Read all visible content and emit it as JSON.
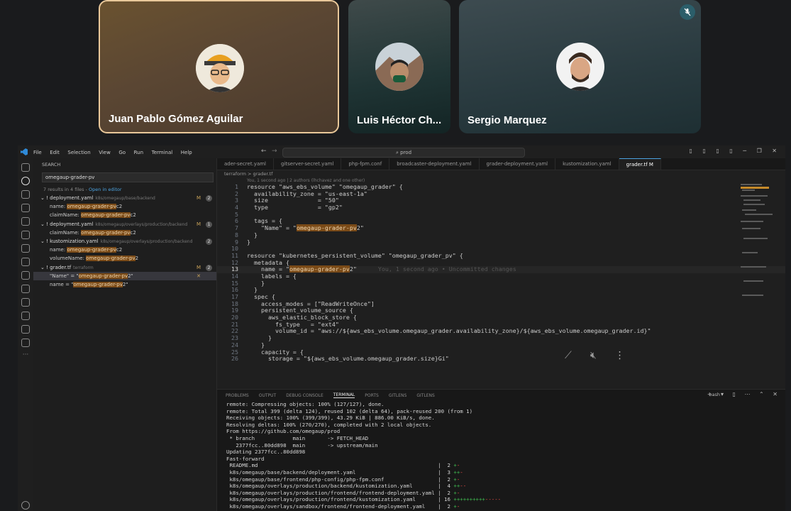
{
  "meeting": {
    "participants": [
      {
        "name": "Juan Pablo Gómez Aguilar",
        "active_speaker": true
      },
      {
        "name": "Luis Héctor Ch...",
        "active_speaker": false
      },
      {
        "name": "Sergio Marquez",
        "active_speaker": false,
        "muted": true
      }
    ]
  },
  "vscode": {
    "menu": [
      "File",
      "Edit",
      "Selection",
      "View",
      "Go",
      "Run",
      "Terminal",
      "Help"
    ],
    "command_center": "prod",
    "sidebar": {
      "title": "SEARCH",
      "query": "omegaup-grader-pv",
      "results_summary": "7 results in 4 files - ",
      "open_in_editor": "Open in editor",
      "files": [
        {
          "name": "deployment.yaml",
          "path": "k8s/omegaup/base/backend",
          "flag": "M",
          "count": "2",
          "matches": [
            [
              "name: ",
              "omegaup-grader-pv",
              "c2"
            ],
            [
              "claimName: ",
              "omegaup-grader-pv",
              "c2"
            ]
          ]
        },
        {
          "name": "deployment.yaml",
          "path": "k8s/omegaup/overlays/production/backend",
          "flag": "M",
          "count": "1",
          "matches": [
            [
              "claimName: ",
              "omegaup-grader-pv",
              "c2"
            ]
          ]
        },
        {
          "name": "kustomization.yaml",
          "path": "k8s/omegaup/overlays/production/backend",
          "flag": "",
          "count": "2",
          "matches": [
            [
              "name: ",
              "omegaup-grader-pv",
              "c2"
            ],
            [
              "volumeName: ",
              "omegaup-grader-pv",
              "2"
            ]
          ]
        },
        {
          "name": "grader.tf",
          "path": "terraform",
          "flag": "M",
          "count": "2",
          "matches": [
            [
              "\"Name\" = \"",
              "omegaup-grader-pv",
              "2\""
            ],
            [
              "name = \"",
              "omegaup-grader-pv",
              "2\""
            ]
          ]
        }
      ]
    },
    "tabs": [
      "ader-secret.yaml",
      "gitserver-secret.yaml",
      "php-fpm.conf",
      "broadcaster-deployment.yaml",
      "grader-deployment.yaml",
      "kustomization.yaml",
      "grader.tf M"
    ],
    "breadcrumb": "terraform > grader.tf",
    "blame": "You, 1 second ago | 2 authors (lhchavez and one other)",
    "inline_blame": "You, 1 second ago • Uncommitted changes",
    "code": [
      [
        "1",
        "resource \"aws_ebs_volume\" \"omegaup_grader\" {"
      ],
      [
        "2",
        "  availability_zone = \"us-east-1a\""
      ],
      [
        "3",
        "  size              = \"50\""
      ],
      [
        "4",
        "  type              = \"gp2\""
      ],
      [
        "5",
        ""
      ],
      [
        "6",
        "  tags = {"
      ],
      [
        "7",
        "    \"Name\" = \"omegaup-grader-pv2\""
      ],
      [
        "8",
        "  }"
      ],
      [
        "9",
        "}"
      ],
      [
        "10",
        ""
      ],
      [
        "11",
        "resource \"kubernetes_persistent_volume\" \"omegaup_grader_pv\" {"
      ],
      [
        "12",
        "  metadata {"
      ],
      [
        "13",
        "    name = \"omegaup-grader-pv2\""
      ],
      [
        "14",
        "    labels = {"
      ],
      [
        "15",
        "    }"
      ],
      [
        "16",
        "  }"
      ],
      [
        "17",
        "  spec {"
      ],
      [
        "18",
        "    access_modes = [\"ReadWriteOnce\"]"
      ],
      [
        "19",
        "    persistent_volume_source {"
      ],
      [
        "20",
        "      aws_elastic_block_store {"
      ],
      [
        "21",
        "        fs_type   = \"ext4\""
      ],
      [
        "22",
        "        volume_id = \"aws://${aws_ebs_volume.omegaup_grader.availability_zone}/${aws_ebs_volume.omegaup_grader.id}\""
      ],
      [
        "23",
        "      }"
      ],
      [
        "24",
        "    }"
      ],
      [
        "25",
        "    capacity = {"
      ],
      [
        "26",
        "      storage = \"${aws_ebs_volume.omegaup_grader.size}Gi\""
      ]
    ],
    "panel_tabs": [
      "PROBLEMS",
      "OUTPUT",
      "DEBUG CONSOLE",
      "TERMINAL",
      "PORTS",
      "GITLENS",
      "GITLENS"
    ],
    "terminal_shell": "bash",
    "terminal": [
      "remote: Compressing objects: 100% (127/127), done.",
      "remote: Total 399 (delta 124), reused 102 (delta 64), pack-reused 200 (from 1)",
      "Receiving objects: 100% (399/399), 43.29 KiB | 886.00 KiB/s, done.",
      "Resolving deltas: 100% (270/270), completed with 2 local objects.",
      "From https://github.com/omegaup/prod",
      " * branch            main       -> FETCH_HEAD",
      "   2377fcc..80dd898  main       -> upstream/main",
      "Updating 2377fcc..80dd898",
      "Fast-forward"
    ],
    "diffstat": [
      [
        "README.md",
        "2",
        "+-"
      ],
      [
        "k8s/omegaup/base/backend/deployment.yaml",
        "3",
        "++-"
      ],
      [
        "k8s/omegaup/base/frontend/php-config/php-fpm.conf",
        "2",
        "+-"
      ],
      [
        "k8s/omegaup/overlays/production/backend/kustomization.yaml",
        "4",
        "++--"
      ],
      [
        "k8s/omegaup/overlays/production/frontend/frontend-deployment.yaml",
        "2",
        "+-"
      ],
      [
        "k8s/omegaup/overlays/production/frontend/kustomization.yaml",
        "16",
        "++++++++++-----"
      ],
      [
        "k8s/omegaup/overlays/sandbox/frontend/frontend-deployment.yaml",
        "2",
        "+-"
      ]
    ]
  }
}
